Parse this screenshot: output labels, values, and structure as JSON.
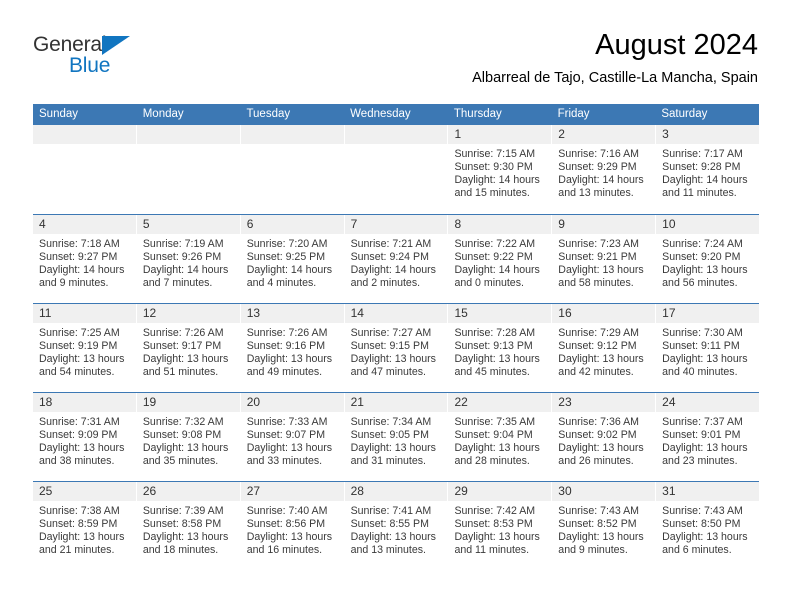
{
  "brand": {
    "name_dark": "General",
    "name_blue": "Blue",
    "accent_color": "#1175c0"
  },
  "header": {
    "title": "August 2024",
    "subtitle": "Albarreal de Tajo, Castille-La Mancha, Spain"
  },
  "calendar": {
    "header_color": "#3c78b4",
    "daynum_band_color": "#f0f0f0",
    "weekdays": [
      "Sunday",
      "Monday",
      "Tuesday",
      "Wednesday",
      "Thursday",
      "Friday",
      "Saturday"
    ],
    "weeks": [
      [
        {
          "day": "",
          "empty": true,
          "sunrise": "",
          "sunset": "",
          "daylight1": "",
          "daylight2": ""
        },
        {
          "day": "",
          "empty": true,
          "sunrise": "",
          "sunset": "",
          "daylight1": "",
          "daylight2": ""
        },
        {
          "day": "",
          "empty": true,
          "sunrise": "",
          "sunset": "",
          "daylight1": "",
          "daylight2": ""
        },
        {
          "day": "",
          "empty": true,
          "sunrise": "",
          "sunset": "",
          "daylight1": "",
          "daylight2": ""
        },
        {
          "day": "1",
          "empty": false,
          "sunrise": "Sunrise: 7:15 AM",
          "sunset": "Sunset: 9:30 PM",
          "daylight1": "Daylight: 14 hours",
          "daylight2": "and 15 minutes."
        },
        {
          "day": "2",
          "empty": false,
          "sunrise": "Sunrise: 7:16 AM",
          "sunset": "Sunset: 9:29 PM",
          "daylight1": "Daylight: 14 hours",
          "daylight2": "and 13 minutes."
        },
        {
          "day": "3",
          "empty": false,
          "sunrise": "Sunrise: 7:17 AM",
          "sunset": "Sunset: 9:28 PM",
          "daylight1": "Daylight: 14 hours",
          "daylight2": "and 11 minutes."
        }
      ],
      [
        {
          "day": "4",
          "empty": false,
          "sunrise": "Sunrise: 7:18 AM",
          "sunset": "Sunset: 9:27 PM",
          "daylight1": "Daylight: 14 hours",
          "daylight2": "and 9 minutes."
        },
        {
          "day": "5",
          "empty": false,
          "sunrise": "Sunrise: 7:19 AM",
          "sunset": "Sunset: 9:26 PM",
          "daylight1": "Daylight: 14 hours",
          "daylight2": "and 7 minutes."
        },
        {
          "day": "6",
          "empty": false,
          "sunrise": "Sunrise: 7:20 AM",
          "sunset": "Sunset: 9:25 PM",
          "daylight1": "Daylight: 14 hours",
          "daylight2": "and 4 minutes."
        },
        {
          "day": "7",
          "empty": false,
          "sunrise": "Sunrise: 7:21 AM",
          "sunset": "Sunset: 9:24 PM",
          "daylight1": "Daylight: 14 hours",
          "daylight2": "and 2 minutes."
        },
        {
          "day": "8",
          "empty": false,
          "sunrise": "Sunrise: 7:22 AM",
          "sunset": "Sunset: 9:22 PM",
          "daylight1": "Daylight: 14 hours",
          "daylight2": "and 0 minutes."
        },
        {
          "day": "9",
          "empty": false,
          "sunrise": "Sunrise: 7:23 AM",
          "sunset": "Sunset: 9:21 PM",
          "daylight1": "Daylight: 13 hours",
          "daylight2": "and 58 minutes."
        },
        {
          "day": "10",
          "empty": false,
          "sunrise": "Sunrise: 7:24 AM",
          "sunset": "Sunset: 9:20 PM",
          "daylight1": "Daylight: 13 hours",
          "daylight2": "and 56 minutes."
        }
      ],
      [
        {
          "day": "11",
          "empty": false,
          "sunrise": "Sunrise: 7:25 AM",
          "sunset": "Sunset: 9:19 PM",
          "daylight1": "Daylight: 13 hours",
          "daylight2": "and 54 minutes."
        },
        {
          "day": "12",
          "empty": false,
          "sunrise": "Sunrise: 7:26 AM",
          "sunset": "Sunset: 9:17 PM",
          "daylight1": "Daylight: 13 hours",
          "daylight2": "and 51 minutes."
        },
        {
          "day": "13",
          "empty": false,
          "sunrise": "Sunrise: 7:26 AM",
          "sunset": "Sunset: 9:16 PM",
          "daylight1": "Daylight: 13 hours",
          "daylight2": "and 49 minutes."
        },
        {
          "day": "14",
          "empty": false,
          "sunrise": "Sunrise: 7:27 AM",
          "sunset": "Sunset: 9:15 PM",
          "daylight1": "Daylight: 13 hours",
          "daylight2": "and 47 minutes."
        },
        {
          "day": "15",
          "empty": false,
          "sunrise": "Sunrise: 7:28 AM",
          "sunset": "Sunset: 9:13 PM",
          "daylight1": "Daylight: 13 hours",
          "daylight2": "and 45 minutes."
        },
        {
          "day": "16",
          "empty": false,
          "sunrise": "Sunrise: 7:29 AM",
          "sunset": "Sunset: 9:12 PM",
          "daylight1": "Daylight: 13 hours",
          "daylight2": "and 42 minutes."
        },
        {
          "day": "17",
          "empty": false,
          "sunrise": "Sunrise: 7:30 AM",
          "sunset": "Sunset: 9:11 PM",
          "daylight1": "Daylight: 13 hours",
          "daylight2": "and 40 minutes."
        }
      ],
      [
        {
          "day": "18",
          "empty": false,
          "sunrise": "Sunrise: 7:31 AM",
          "sunset": "Sunset: 9:09 PM",
          "daylight1": "Daylight: 13 hours",
          "daylight2": "and 38 minutes."
        },
        {
          "day": "19",
          "empty": false,
          "sunrise": "Sunrise: 7:32 AM",
          "sunset": "Sunset: 9:08 PM",
          "daylight1": "Daylight: 13 hours",
          "daylight2": "and 35 minutes."
        },
        {
          "day": "20",
          "empty": false,
          "sunrise": "Sunrise: 7:33 AM",
          "sunset": "Sunset: 9:07 PM",
          "daylight1": "Daylight: 13 hours",
          "daylight2": "and 33 minutes."
        },
        {
          "day": "21",
          "empty": false,
          "sunrise": "Sunrise: 7:34 AM",
          "sunset": "Sunset: 9:05 PM",
          "daylight1": "Daylight: 13 hours",
          "daylight2": "and 31 minutes."
        },
        {
          "day": "22",
          "empty": false,
          "sunrise": "Sunrise: 7:35 AM",
          "sunset": "Sunset: 9:04 PM",
          "daylight1": "Daylight: 13 hours",
          "daylight2": "and 28 minutes."
        },
        {
          "day": "23",
          "empty": false,
          "sunrise": "Sunrise: 7:36 AM",
          "sunset": "Sunset: 9:02 PM",
          "daylight1": "Daylight: 13 hours",
          "daylight2": "and 26 minutes."
        },
        {
          "day": "24",
          "empty": false,
          "sunrise": "Sunrise: 7:37 AM",
          "sunset": "Sunset: 9:01 PM",
          "daylight1": "Daylight: 13 hours",
          "daylight2": "and 23 minutes."
        }
      ],
      [
        {
          "day": "25",
          "empty": false,
          "sunrise": "Sunrise: 7:38 AM",
          "sunset": "Sunset: 8:59 PM",
          "daylight1": "Daylight: 13 hours",
          "daylight2": "and 21 minutes."
        },
        {
          "day": "26",
          "empty": false,
          "sunrise": "Sunrise: 7:39 AM",
          "sunset": "Sunset: 8:58 PM",
          "daylight1": "Daylight: 13 hours",
          "daylight2": "and 18 minutes."
        },
        {
          "day": "27",
          "empty": false,
          "sunrise": "Sunrise: 7:40 AM",
          "sunset": "Sunset: 8:56 PM",
          "daylight1": "Daylight: 13 hours",
          "daylight2": "and 16 minutes."
        },
        {
          "day": "28",
          "empty": false,
          "sunrise": "Sunrise: 7:41 AM",
          "sunset": "Sunset: 8:55 PM",
          "daylight1": "Daylight: 13 hours",
          "daylight2": "and 13 minutes."
        },
        {
          "day": "29",
          "empty": false,
          "sunrise": "Sunrise: 7:42 AM",
          "sunset": "Sunset: 8:53 PM",
          "daylight1": "Daylight: 13 hours",
          "daylight2": "and 11 minutes."
        },
        {
          "day": "30",
          "empty": false,
          "sunrise": "Sunrise: 7:43 AM",
          "sunset": "Sunset: 8:52 PM",
          "daylight1": "Daylight: 13 hours",
          "daylight2": "and 9 minutes."
        },
        {
          "day": "31",
          "empty": false,
          "sunrise": "Sunrise: 7:43 AM",
          "sunset": "Sunset: 8:50 PM",
          "daylight1": "Daylight: 13 hours",
          "daylight2": "and 6 minutes."
        }
      ]
    ]
  }
}
